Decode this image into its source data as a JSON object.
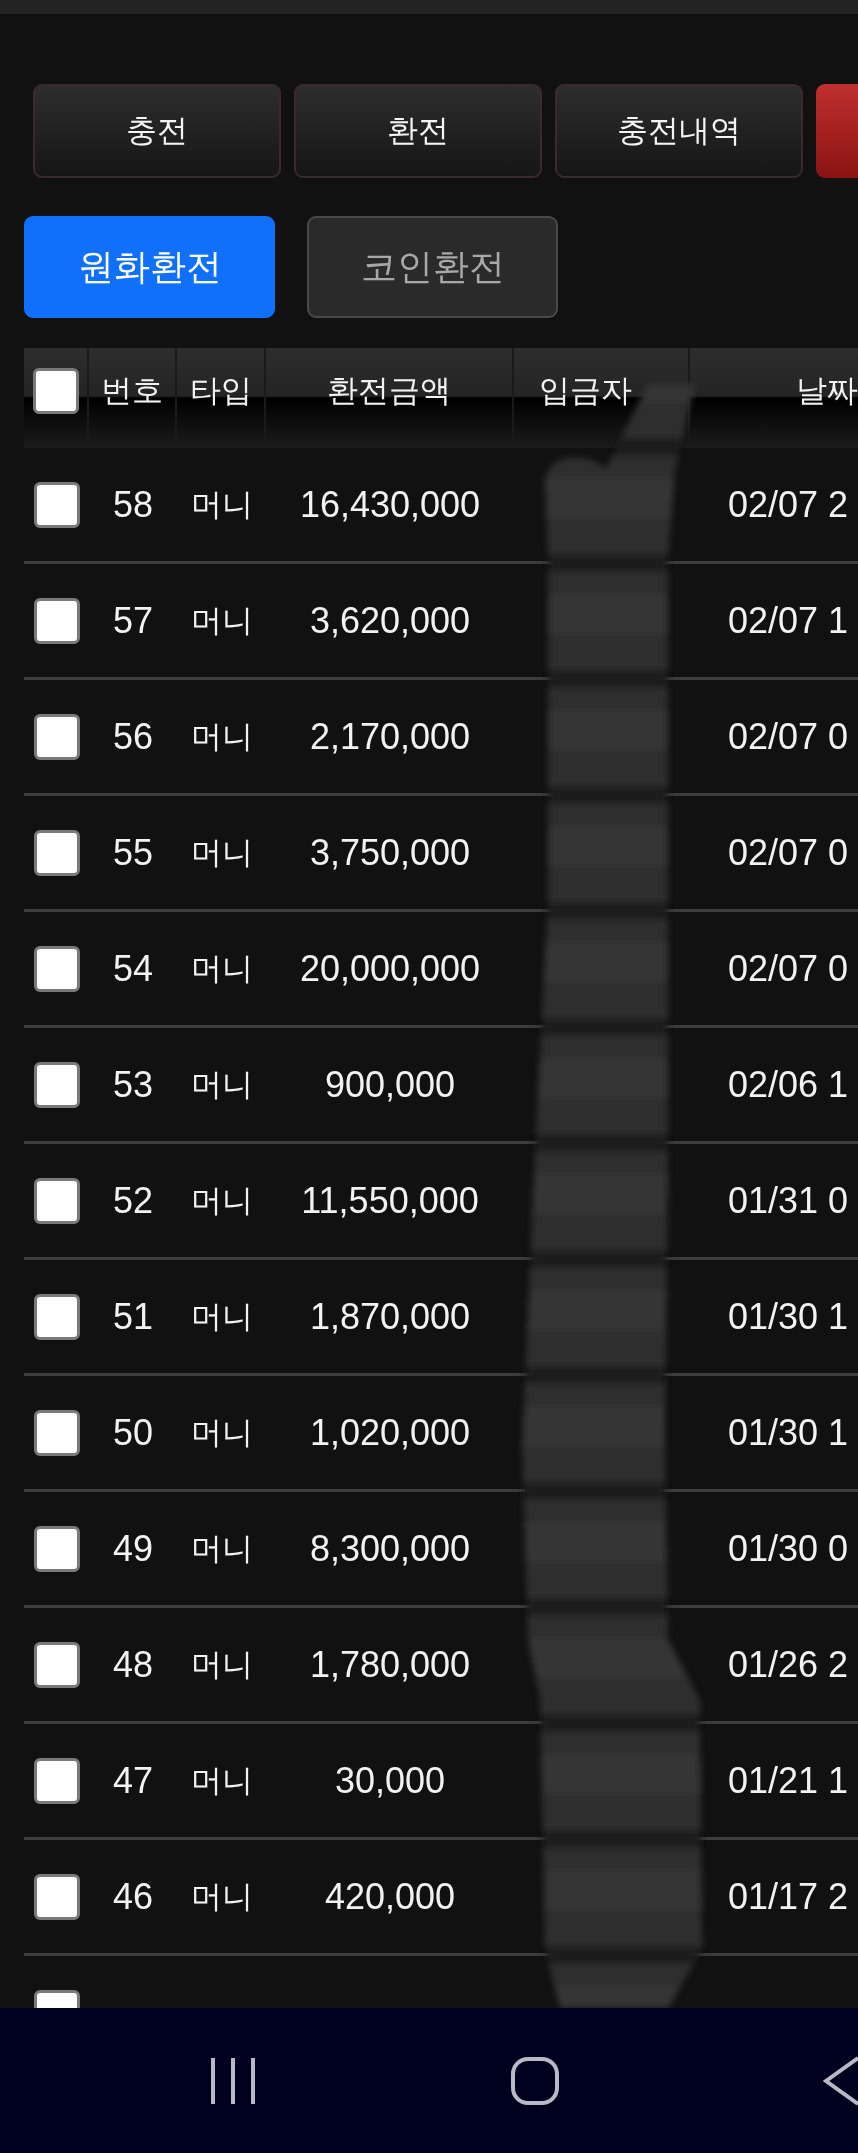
{
  "top_buttons": [
    {
      "label": "충전",
      "kind": "normal"
    },
    {
      "label": "환전",
      "kind": "normal"
    },
    {
      "label": "충전내역",
      "kind": "normal"
    },
    {
      "kind": "accent"
    }
  ],
  "tabs": [
    {
      "label": "원화환전",
      "selected": true
    },
    {
      "label": "코인환전",
      "selected": false
    }
  ],
  "table": {
    "select_all": {
      "checked": false
    },
    "columns": [
      "번호",
      "타입",
      "환전금액",
      "입금자",
      "날짜"
    ],
    "rows": [
      {
        "checked": false,
        "number": "58",
        "type": "머니",
        "amount": "16,430,000",
        "date": "02/07 2"
      },
      {
        "checked": false,
        "number": "57",
        "type": "머니",
        "amount": "3,620,000",
        "date": "02/07 1"
      },
      {
        "checked": false,
        "number": "56",
        "type": "머니",
        "amount": "2,170,000",
        "date": "02/07 0"
      },
      {
        "checked": false,
        "number": "55",
        "type": "머니",
        "amount": "3,750,000",
        "date": "02/07 0"
      },
      {
        "checked": false,
        "number": "54",
        "type": "머니",
        "amount": "20,000,000",
        "date": "02/07 0"
      },
      {
        "checked": false,
        "number": "53",
        "type": "머니",
        "amount": "900,000",
        "date": "02/06 1"
      },
      {
        "checked": false,
        "number": "52",
        "type": "머니",
        "amount": "11,550,000",
        "date": "01/31 0"
      },
      {
        "checked": false,
        "number": "51",
        "type": "머니",
        "amount": "1,870,000",
        "date": "01/30 1"
      },
      {
        "checked": false,
        "number": "50",
        "type": "머니",
        "amount": "1,020,000",
        "date": "01/30 1"
      },
      {
        "checked": false,
        "number": "49",
        "type": "머니",
        "amount": "8,300,000",
        "date": "01/30 0"
      },
      {
        "checked": false,
        "number": "48",
        "type": "머니",
        "amount": "1,780,000",
        "date": "01/26 2"
      },
      {
        "checked": false,
        "number": "47",
        "type": "머니",
        "amount": "30,000",
        "date": "01/21 1"
      },
      {
        "checked": false,
        "number": "46",
        "type": "머니",
        "amount": "420,000",
        "date": "01/17 2"
      },
      {
        "checked": false
      }
    ]
  }
}
